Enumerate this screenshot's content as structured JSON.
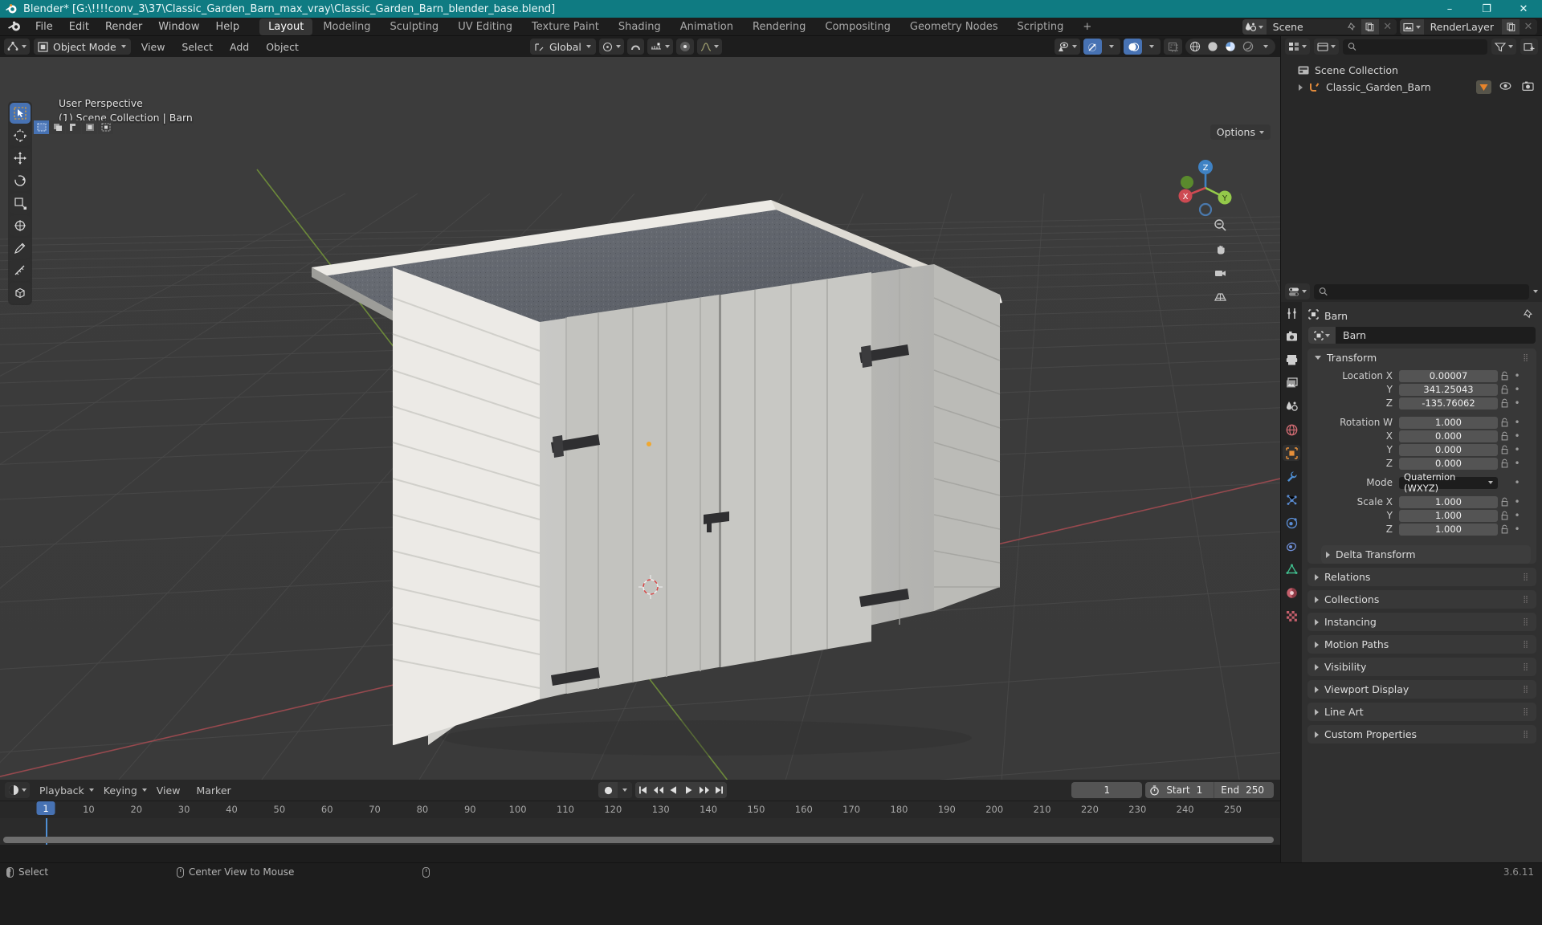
{
  "titlebar": {
    "title": "Blender* [G:\\!!!!conv_3\\37\\Classic_Garden_Barn_max_vray\\Classic_Garden_Barn_blender_base.blend]",
    "minimize": "–",
    "maximize": "❐",
    "close": "✕"
  },
  "menubar": {
    "items": [
      "File",
      "Edit",
      "Render",
      "Window",
      "Help"
    ],
    "workspace_tabs": [
      {
        "label": "Layout",
        "active": true
      },
      {
        "label": "Modeling",
        "active": false
      },
      {
        "label": "Sculpting",
        "active": false
      },
      {
        "label": "UV Editing",
        "active": false
      },
      {
        "label": "Texture Paint",
        "active": false
      },
      {
        "label": "Shading",
        "active": false
      },
      {
        "label": "Animation",
        "active": false
      },
      {
        "label": "Rendering",
        "active": false
      },
      {
        "label": "Compositing",
        "active": false
      },
      {
        "label": "Geometry Nodes",
        "active": false
      },
      {
        "label": "Scripting",
        "active": false
      }
    ],
    "add_workspace": "+",
    "scene_name": "Scene",
    "viewlayer_name": "RenderLayer"
  },
  "viewport": {
    "mode": "Object Mode",
    "menus": [
      "View",
      "Select",
      "Add",
      "Object"
    ],
    "transform_orientation": "Global",
    "overlay_line1": "User Perspective",
    "overlay_line2": "(1) Scene Collection | Barn",
    "options_label": "Options",
    "gizmo_axes": {
      "x": "X",
      "y": "Y",
      "z": "Z"
    },
    "axis_colors": {
      "x": "#cd4a52",
      "y": "#94c94a",
      "z": "#3f82c4"
    }
  },
  "outliner": {
    "search_placeholder": "",
    "rows": [
      {
        "label": "Scene Collection",
        "type": "collection",
        "indent": 0
      },
      {
        "label": "Classic_Garden_Barn",
        "type": "object",
        "indent": 1
      }
    ]
  },
  "properties": {
    "breadcrumb": "Barn",
    "id_name": "Barn",
    "transform": {
      "title": "Transform",
      "fields": [
        {
          "label": "Location X",
          "value": "0.00007"
        },
        {
          "label": "Y",
          "value": "341.25043"
        },
        {
          "label": "Z",
          "value": "-135.76062"
        },
        {
          "label": "Rotation W",
          "value": "1.000"
        },
        {
          "label": "X",
          "value": "0.000"
        },
        {
          "label": "Y",
          "value": "0.000"
        },
        {
          "label": "Z",
          "value": "0.000"
        }
      ],
      "mode_label": "Mode",
      "mode_value": "Quaternion (WXYZ)",
      "scale": [
        {
          "label": "Scale X",
          "value": "1.000"
        },
        {
          "label": "Y",
          "value": "1.000"
        },
        {
          "label": "Z",
          "value": "1.000"
        }
      ],
      "delta_transform": "Delta Transform"
    },
    "panels": [
      "Relations",
      "Collections",
      "Instancing",
      "Motion Paths",
      "Visibility",
      "Viewport Display",
      "Line Art",
      "Custom Properties"
    ]
  },
  "timeline": {
    "menus": [
      "Playback",
      "Keying",
      "View",
      "Marker"
    ],
    "current_frame": "1",
    "start_label": "Start",
    "start_value": "1",
    "end_label": "End",
    "end_value": "250",
    "ticks": [
      10,
      20,
      30,
      40,
      50,
      60,
      70,
      80,
      90,
      100,
      110,
      120,
      130,
      140,
      150,
      160,
      170,
      180,
      190,
      200,
      210,
      220,
      230,
      240,
      250
    ],
    "playhead_frame": "1"
  },
  "statusbar": {
    "hint1": "Select",
    "hint2": "Center View to Mouse",
    "version": "3.6.11"
  }
}
